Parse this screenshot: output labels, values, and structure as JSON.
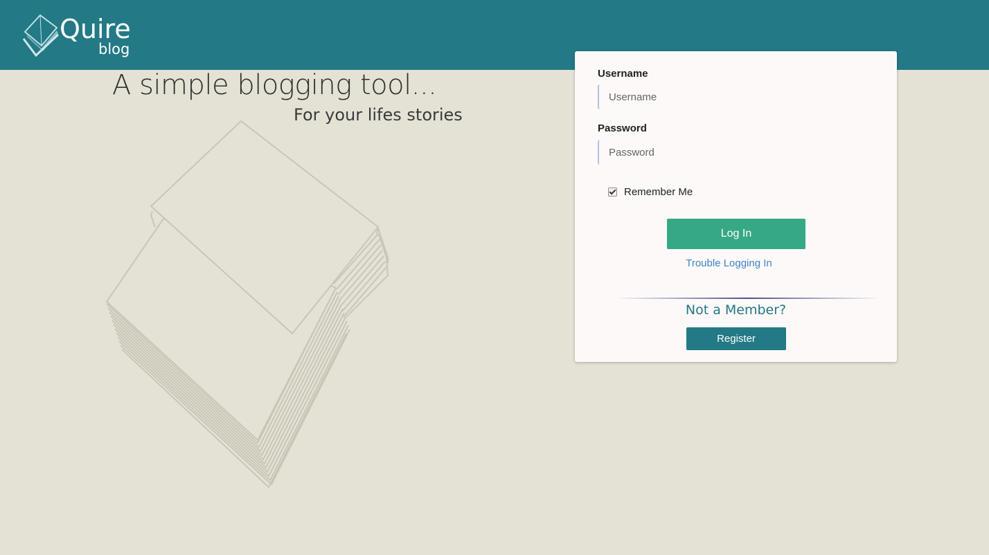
{
  "brand": {
    "name": "Quire",
    "sub": "blog",
    "logo_icon": "book-check-icon"
  },
  "hero": {
    "tagline": "A simple blogging tool...",
    "subtagline": "For your lifes stories",
    "illustration_icon": "paper-stack-icon"
  },
  "login": {
    "username_label": "Username",
    "username_placeholder": "Username",
    "username_value": "",
    "password_label": "Password",
    "password_placeholder": "Password",
    "password_value": "",
    "remember_label": "Remember Me",
    "remember_checked": true,
    "login_button": "Log In",
    "trouble_link": "Trouble Logging In",
    "not_member": "Not a Member?",
    "register_button": "Register"
  },
  "colors": {
    "header": "#237986",
    "background": "#e4e2d5",
    "login_button": "#37a886",
    "register_button": "#237986",
    "link": "#3d85c6"
  }
}
